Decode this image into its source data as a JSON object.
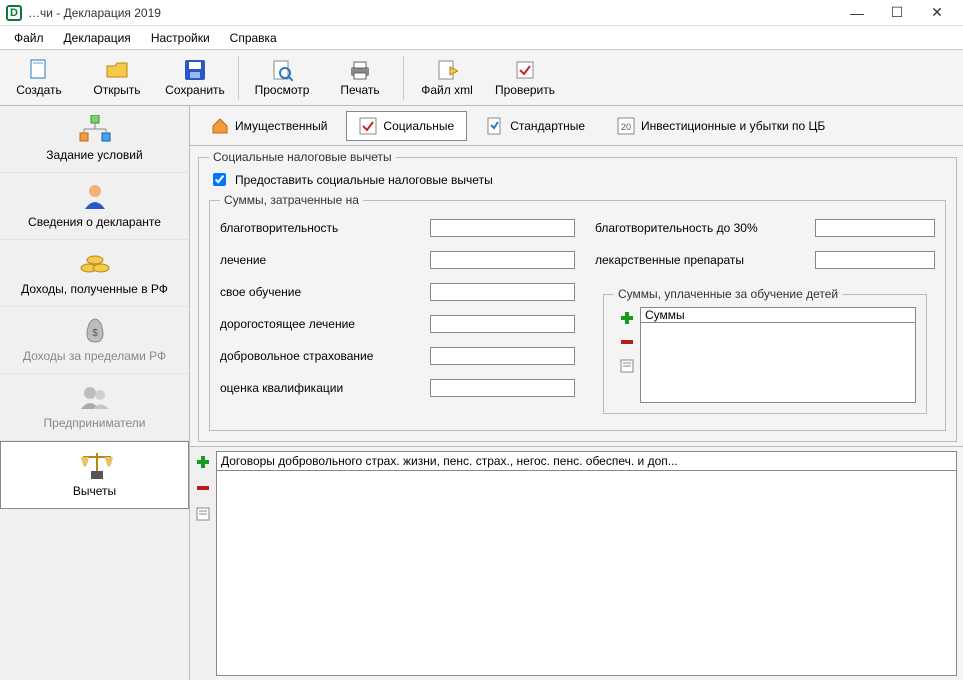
{
  "title": "…чи - Декларация 2019",
  "menus": [
    "Файл",
    "Декларация",
    "Настройки",
    "Справка"
  ],
  "toolbar": {
    "create": "Создать",
    "open": "Открыть",
    "save": "Сохранить",
    "preview": "Просмотр",
    "print": "Печать",
    "xml": "Файл xml",
    "check": "Проверить"
  },
  "sidebar": {
    "conditions": "Задание условий",
    "declarant": "Сведения о декларанте",
    "income_rf": "Доходы, полученные в РФ",
    "income_abroad": "Доходы за пределами РФ",
    "entrepreneurs": "Предприниматели",
    "deductions": "Вычеты"
  },
  "tabs": {
    "property": "Имущественный",
    "social": "Социальные",
    "standard": "Стандартные",
    "invest": "Инвестиционные и убытки по ЦБ"
  },
  "social": {
    "fs_title": "Социальные налоговые вычеты",
    "provide": "Предоставить социальные налоговые вычеты",
    "sums_title": "Суммы, затраченные на",
    "charity": "благотворительность",
    "medical": "лечение",
    "own_edu": "свое обучение",
    "expensive_med": "дорогостоящее лечение",
    "voluntary_ins": "добровольное страхование",
    "qualification": "оценка квалификации",
    "charity30": "благотворительность до 30%",
    "medicines": "лекарственные препараты",
    "children_fs": "Суммы, уплаченные за обучение детей",
    "children_col": "Суммы",
    "bottom_col": "Договоры добровольного страх. жизни, пенс. страх., негос. пенс. обеспеч. и доп..."
  }
}
